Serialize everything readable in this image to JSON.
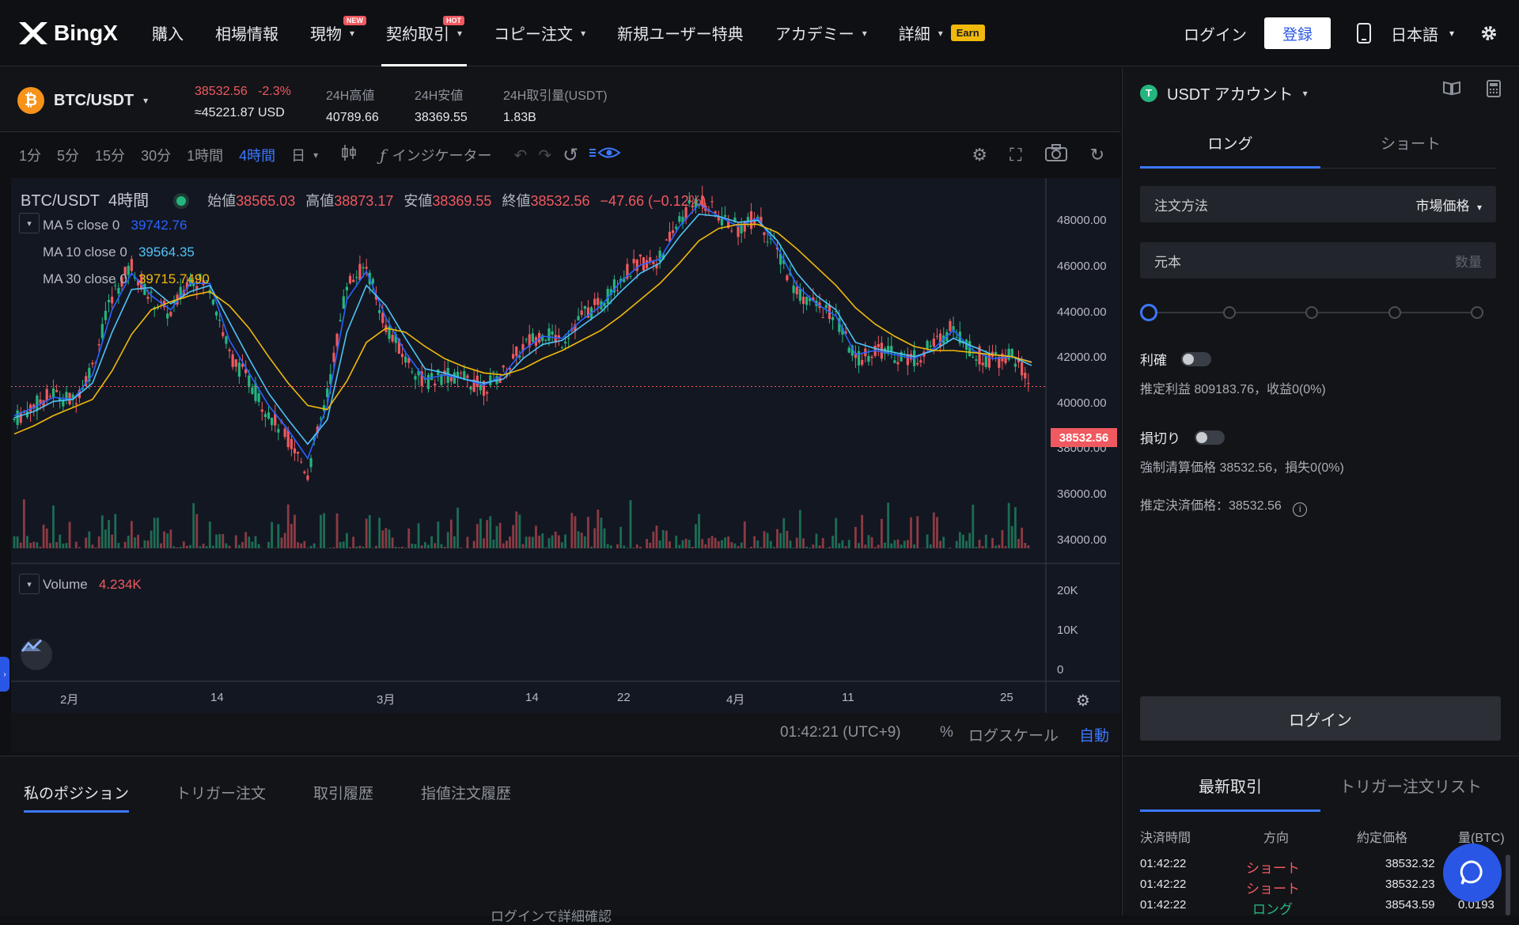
{
  "header": {
    "brand": "BingX",
    "nav": [
      {
        "label": "購入"
      },
      {
        "label": "相場情報"
      },
      {
        "label": "現物",
        "badge": "NEW"
      },
      {
        "label": "契約取引",
        "badge": "HOT"
      },
      {
        "label": "コピー注文"
      },
      {
        "label": "新規ユーザー特典"
      },
      {
        "label": "アカデミー"
      },
      {
        "label": "詳細",
        "tag": "Earn"
      }
    ],
    "login": "ログイン",
    "signup": "登録",
    "language": "日本語"
  },
  "ticker": {
    "pair": "BTC/USDT",
    "last_price": "38532.56",
    "change": "-2.3%",
    "usd_equiv": "≈45221.87 USD",
    "high_label": "24H高値",
    "high": "40789.66",
    "low_label": "24H安値",
    "low": "38369.55",
    "vol_label": "24H取引量(USDT)",
    "vol": "1.83B"
  },
  "toolbar": {
    "timeframes": [
      "1分",
      "5分",
      "15分",
      "30分",
      "1時間",
      "4時間",
      "日"
    ],
    "active_timeframe": "4時間",
    "indicator": "インジケーター"
  },
  "chart": {
    "title": "BTC/USDT",
    "interval": "4時間",
    "ohlc": {
      "open_label": "始値",
      "open": "38565.03",
      "high_label": "高値",
      "high": "38873.17",
      "low_label": "安値",
      "low": "38369.55",
      "close_label": "終値",
      "close": "38532.56",
      "change": "−47.66 (−0.12%)"
    },
    "ma": [
      {
        "label": "MA 5 close 0",
        "value": "39742.76",
        "color": "#2962ff"
      },
      {
        "label": "MA 10 close 0",
        "value": "39564.35",
        "color": "#4fc3f7"
      },
      {
        "label": "MA 30 close 0",
        "value": "39715.7490",
        "color": "#f0b90b"
      }
    ],
    "volume_label": "Volume",
    "volume_value": "4.234K",
    "current_price_tag": "38532.56",
    "y_ticks": [
      "48000.00",
      "46000.00",
      "44000.00",
      "42000.00",
      "40000.00",
      "38000.00",
      "36000.00",
      "34000.00"
    ],
    "vol_ticks": [
      "20K",
      "10K",
      "0"
    ],
    "x_ticks": [
      "2月",
      "14",
      "3月",
      "14",
      "22",
      "4月",
      "11",
      "25"
    ],
    "footer_time": "01:42:21 (UTC+9)",
    "footer_pct": "%",
    "footer_log": "ログスケール",
    "footer_auto": "自動"
  },
  "chart_data": {
    "type": "candlestick",
    "title": "BTC/USDT 4時間",
    "x": [
      "2月",
      "14",
      "3月",
      "14",
      "22",
      "4月",
      "11",
      "25"
    ],
    "series": [
      {
        "name": "price",
        "values": [
          36900,
          37600,
          38200,
          37800,
          39500,
          43000,
          44500,
          42800,
          42100,
          43900,
          43500,
          40100,
          38800,
          37200,
          36000,
          34300,
          38100,
          43600,
          44400,
          41500,
          39900,
          38700,
          39100,
          38900,
          38500,
          39200,
          40500,
          41200,
          40800,
          42000,
          42600,
          43900,
          44600,
          44800,
          46700,
          47800,
          46900,
          46300,
          46900,
          45200,
          43200,
          42500,
          41900,
          39800,
          40400,
          40100,
          39900,
          40600,
          41500,
          40200,
          39800,
          40100,
          38532.56
        ]
      },
      {
        "name": "MA 5 close 0",
        "values": [
          37100,
          37500,
          38000,
          37900,
          39100,
          42300,
          44100,
          43000,
          42300,
          43600,
          43600,
          40800,
          39200,
          37600,
          36400,
          35000,
          37600,
          42800,
          44200,
          41900,
          40200,
          38900,
          39100,
          38900,
          38600,
          39100,
          40300,
          41000,
          40900,
          41800,
          42500,
          43700,
          44500,
          44800,
          46400,
          47500,
          46900,
          46400,
          46800,
          45400,
          43500,
          42600,
          42000,
          40100,
          40300,
          40100,
          39900,
          40400,
          41300,
          40300,
          39900,
          40000,
          39742.76
        ]
      },
      {
        "name": "MA 10 close 0",
        "values": [
          37000,
          37300,
          37800,
          37900,
          38700,
          41200,
          43300,
          43400,
          42600,
          43200,
          43500,
          41700,
          39900,
          38200,
          36900,
          35700,
          36900,
          41200,
          43500,
          42500,
          40900,
          39400,
          39200,
          38900,
          38700,
          38900,
          39900,
          40600,
          40800,
          41500,
          42200,
          43200,
          44100,
          44600,
          45900,
          47000,
          46900,
          46600,
          46700,
          45700,
          44100,
          43000,
          42300,
          40700,
          40400,
          40200,
          40000,
          40300,
          40900,
          40500,
          40100,
          40000,
          39564.35
        ]
      },
      {
        "name": "MA 30 close 0",
        "values": [
          36200,
          36600,
          37100,
          37500,
          37900,
          39300,
          41100,
          42300,
          42700,
          43000,
          43200,
          42500,
          41400,
          40000,
          38700,
          37600,
          37400,
          38800,
          40700,
          41400,
          41200,
          40500,
          39900,
          39500,
          39200,
          39100,
          39400,
          39900,
          40300,
          40800,
          41300,
          42000,
          42800,
          43600,
          44600,
          45700,
          46300,
          46500,
          46500,
          46100,
          45300,
          44400,
          43500,
          42400,
          41600,
          41000,
          40500,
          40300,
          40300,
          40200,
          40100,
          40000,
          39715.749
        ]
      }
    ],
    "volume_series": [
      {
        "name": "Volume",
        "last": "4.234K"
      }
    ],
    "ylim": [
      34000,
      48000
    ],
    "volume_ylim": [
      0,
      20000
    ],
    "ylabel": "",
    "xlabel": "",
    "grid": false,
    "scale": "linear"
  },
  "bottom": {
    "tabs": [
      "私のポジション",
      "トリガー注文",
      "取引履歴",
      "指値注文履歴"
    ],
    "hint": "ログインで詳細確認"
  },
  "order": {
    "account": "USDT アカウント",
    "tabs": [
      "ロング",
      "ショート"
    ],
    "method_label": "注文方法",
    "method_value": "市場価格",
    "principal_label": "元本",
    "principal_placeholder": "数量",
    "slider_percent": 0,
    "tp_label": "利確",
    "tp_info": "推定利益 809183.76，收益0(0%)",
    "sl_label": "損切り",
    "sl_info": "強制清算価格 38532.56，損失0(0%)",
    "settle_info": "推定決済価格：38532.56",
    "login_btn": "ログイン"
  },
  "trades": {
    "tabs": [
      "最新取引",
      "トリガー注文リスト"
    ],
    "headers": [
      "決済時間",
      "方向",
      "約定価格",
      "量(BTC)"
    ],
    "rows": [
      {
        "time": "01:42:22",
        "side": "ショート",
        "price": "38532.32",
        "qty": ""
      },
      {
        "time": "01:42:22",
        "side": "ショート",
        "price": "38532.23",
        "qty": ""
      },
      {
        "time": "01:42:22",
        "side": "ロング",
        "price": "38543.59",
        "qty": "0.0193"
      }
    ]
  },
  "colors": {
    "accent": "#3b78ff",
    "down": "#f0595f",
    "up": "#25b57e",
    "earn": "#f0b90b"
  }
}
